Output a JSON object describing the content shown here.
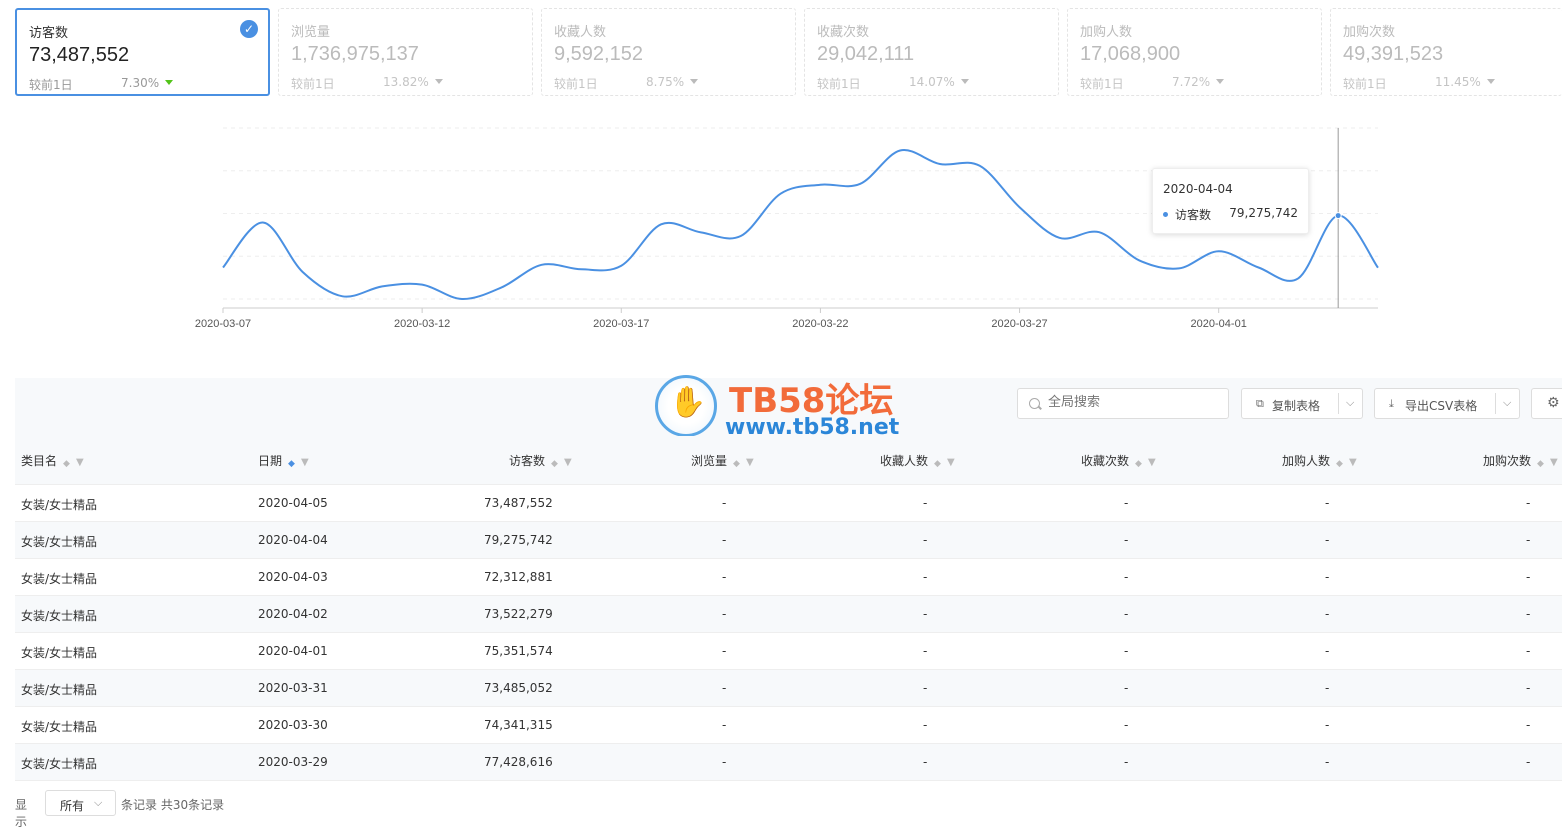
{
  "cards": [
    {
      "title": "访客数",
      "value": "73,487,552",
      "compare": "较前1日",
      "pct": "7.30%",
      "active": true
    },
    {
      "title": "浏览量",
      "value": "1,736,975,137",
      "compare": "较前1日",
      "pct": "13.82%"
    },
    {
      "title": "收藏人数",
      "value": "9,592,152",
      "compare": "较前1日",
      "pct": "8.75%"
    },
    {
      "title": "收藏次数",
      "value": "29,042,111",
      "compare": "较前1日",
      "pct": "14.07%"
    },
    {
      "title": "加购人数",
      "value": "17,068,900",
      "compare": "较前1日",
      "pct": "7.72%"
    },
    {
      "title": "加购次数",
      "value": "49,391,523",
      "compare": "较前1日",
      "pct": "11.45%"
    }
  ],
  "chart_data": {
    "type": "line",
    "x": [
      "2020-03-07",
      "2020-03-08",
      "2020-03-09",
      "2020-03-10",
      "2020-03-11",
      "2020-03-12",
      "2020-03-13",
      "2020-03-14",
      "2020-03-15",
      "2020-03-16",
      "2020-03-17",
      "2020-03-18",
      "2020-03-19",
      "2020-03-20",
      "2020-03-21",
      "2020-03-22",
      "2020-03-23",
      "2020-03-24",
      "2020-03-25",
      "2020-03-26",
      "2020-03-27",
      "2020-03-28",
      "2020-03-29",
      "2020-03-30",
      "2020-03-31",
      "2020-04-01",
      "2020-04-02",
      "2020-04-03",
      "2020-04-04",
      "2020-04-05"
    ],
    "xticks": [
      "2020-03-07",
      "2020-03-12",
      "2020-03-17",
      "2020-03-22",
      "2020-03-27",
      "2020-04-01"
    ],
    "series": [
      {
        "name": "访客数",
        "values": [
          73500000,
          78500000,
          73000000,
          70300000,
          71400000,
          71600000,
          70000000,
          71300000,
          73800000,
          73300000,
          73700000,
          78300000,
          77400000,
          77000000,
          81700000,
          82700000,
          82800000,
          86500000,
          85000000,
          84800000,
          80200000,
          76800000,
          77420000,
          74300000,
          73400000,
          75300000,
          73500000,
          72300000,
          79270000,
          73480000
        ]
      }
    ],
    "ylim": [
      69000000,
      89000000
    ],
    "grid": true,
    "tooltip": {
      "date": "2020-04-04",
      "label": "访客数",
      "value": "79,275,742",
      "index": 28
    }
  },
  "toolbar": {
    "search_placeholder": "全局搜索",
    "copy_label": "复制表格",
    "export_label": "导出CSV表格",
    "copy_icon": "copy-icon",
    "export_icon": "download-icon",
    "settings_icon": "gear-icon"
  },
  "table": {
    "columns": [
      "类目名",
      "日期",
      "访客数",
      "浏览量",
      "收藏人数",
      "收藏次数",
      "加购人数",
      "加购次数"
    ],
    "rows": [
      [
        "女装/女士精品",
        "2020-04-05",
        "73,487,552",
        "-",
        "-",
        "-",
        "-",
        "-"
      ],
      [
        "女装/女士精品",
        "2020-04-04",
        "79,275,742",
        "-",
        "-",
        "-",
        "-",
        "-"
      ],
      [
        "女装/女士精品",
        "2020-04-03",
        "72,312,881",
        "-",
        "-",
        "-",
        "-",
        "-"
      ],
      [
        "女装/女士精品",
        "2020-04-02",
        "73,522,279",
        "-",
        "-",
        "-",
        "-",
        "-"
      ],
      [
        "女装/女士精品",
        "2020-04-01",
        "75,351,574",
        "-",
        "-",
        "-",
        "-",
        "-"
      ],
      [
        "女装/女士精品",
        "2020-03-31",
        "73,485,052",
        "-",
        "-",
        "-",
        "-",
        "-"
      ],
      [
        "女装/女士精品",
        "2020-03-30",
        "74,341,315",
        "-",
        "-",
        "-",
        "-",
        "-"
      ],
      [
        "女装/女士精品",
        "2020-03-29",
        "77,428,616",
        "-",
        "-",
        "-",
        "-",
        "-"
      ]
    ]
  },
  "footer": {
    "show_label": "显示",
    "page_size": "所有",
    "records": "条记录 共30条记录"
  },
  "watermark": {
    "title": "TB58论坛",
    "url": "www.tb58.net"
  },
  "colors": {
    "accent": "#4a90e2",
    "up": "#52c41a"
  }
}
